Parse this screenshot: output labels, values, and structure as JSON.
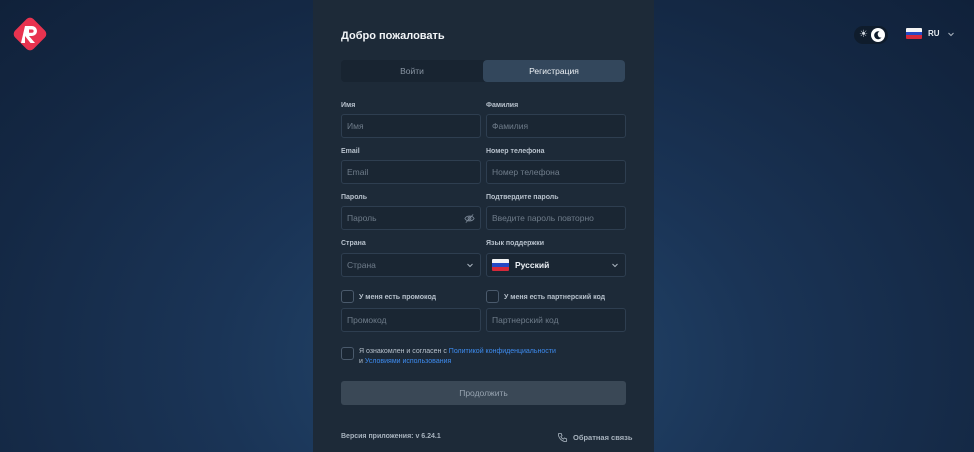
{
  "app": {
    "logo_text": "R",
    "colors": {
      "brand": "#e8334f",
      "link": "#3d8bef",
      "panel": "#1d2a38"
    }
  },
  "header": {
    "theme_toggle": {
      "mode": "dark",
      "icons": [
        "sun-icon",
        "moon-icon"
      ]
    },
    "language": {
      "code": "RU",
      "flag": "russia-flag-icon"
    }
  },
  "form": {
    "title": "Добро пожаловать",
    "tabs": [
      {
        "label": "Войти",
        "active": false
      },
      {
        "label": "Регистрация",
        "active": true
      }
    ],
    "fields": {
      "first_name": {
        "label": "Имя",
        "placeholder": "Имя"
      },
      "last_name": {
        "label": "Фамилия",
        "placeholder": "Фамилия"
      },
      "email": {
        "label": "Email",
        "placeholder": "Email"
      },
      "phone": {
        "label": "Номер телефона",
        "placeholder": "Номер телефона"
      },
      "password": {
        "label": "Пароль",
        "placeholder": "Пароль"
      },
      "confirm_password": {
        "label": "Подтвердите пароль",
        "placeholder": "Введите пароль повторно"
      },
      "country": {
        "label": "Страна",
        "value": "Страна"
      },
      "support_language": {
        "label": "Язык поддержки",
        "value": "Русский"
      },
      "promo": {
        "checkbox_label": "У меня есть промокод",
        "placeholder": "Промокод",
        "checked": false
      },
      "partner": {
        "checkbox_label": "У меня есть партнерский код",
        "placeholder": "Партнерский код",
        "checked": false
      }
    },
    "agreement": {
      "checked": false,
      "text_prefix": "Я ознакомлен и согласен с ",
      "privacy_link": "Политикой конфиденциальности",
      "text_middle": "и ",
      "terms_link": "Условиями использования"
    },
    "submit_label": "Продолжить"
  },
  "footer": {
    "version": "Версия приложения: v 6.24.1",
    "feedback": "Обратная связь"
  }
}
